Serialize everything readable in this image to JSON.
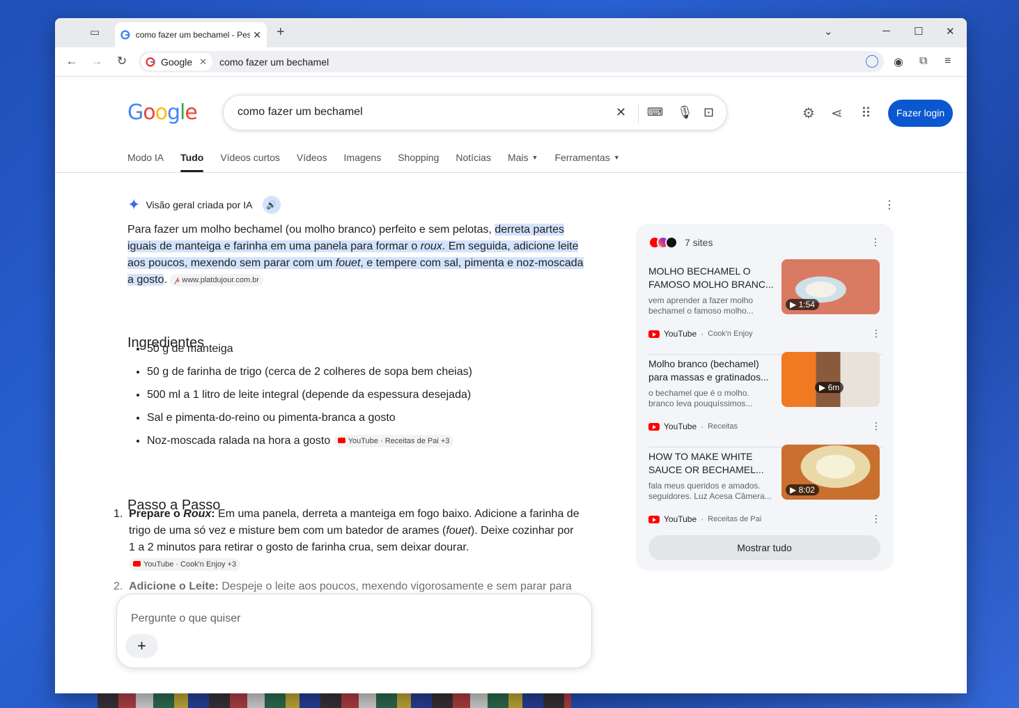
{
  "browser": {
    "tab_title": "como fazer um bechamel - Pesquisa Google",
    "omnibox_chip": "Google",
    "omnibox_text": "como fazer um bechamel"
  },
  "header": {
    "search_query": "como fazer um bechamel",
    "login_label": "Fazer login"
  },
  "tabs": [
    {
      "label": "Modo IA"
    },
    {
      "label": "Tudo"
    },
    {
      "label": "Vídeos curtos"
    },
    {
      "label": "Vídeos"
    },
    {
      "label": "Imagens"
    },
    {
      "label": "Shopping"
    },
    {
      "label": "Notícias"
    },
    {
      "label": "Mais"
    },
    {
      "label": "Ferramentas"
    }
  ],
  "ai": {
    "heading": "Visão geral criada por IA",
    "summary_plain": "Para fazer um molho bechamel (ou molho branco) perfeito e sem pelotas, ",
    "summary_hl1": "derreta partes iguais de manteiga e farinha em uma panela para formar o ",
    "summary_hl_roux": "roux",
    "summary_hl2": ". Em seguida, adicione leite aos poucos, mexendo sem parar com um ",
    "summary_hl_fouet": "fouet",
    "summary_hl3": ", e tempere com sal, pimenta e noz-moscada a gosto",
    "summary_end": ".",
    "summary_source": "www.platdujour.com.br",
    "ingredients_title": "Ingredientes",
    "ingredients": [
      "50 g de manteiga",
      "50 g de farinha de trigo (cerca de 2 colheres de sopa bem cheias)",
      "500 ml a 1 litro de leite integral (depende da espessura desejada)",
      "Sal e pimenta-do-reino ou pimenta-branca a gosto",
      "Noz-moscada ralada na hora a gosto"
    ],
    "ingredients_source": "YouTube · Receitas de Pai +3",
    "steps_title": "Passo a Passo",
    "step1_num": "1.",
    "step1_bold_a": "Prepare o ",
    "step1_bold_i": "Roux",
    "step1_bold_b": ":",
    "step1_text_a": " Em uma panela, derreta a manteiga em fogo baixo. Adicione a farinha de trigo de uma só vez e misture bem com um batedor de arames (",
    "step1_text_i": "fouet",
    "step1_text_b": "). Deixe cozinhar por 1 a 2 minutos para retirar o gosto de farinha crua, sem deixar dourar.",
    "step1_source": "YouTube · Cook'n Enjoy +3",
    "step2_num": "2.",
    "step2_bold": "Adicione o Leite:",
    "step2_text": " Despeje o leite aos poucos, mexendo vigorosamente e sem parar para"
  },
  "askbar": {
    "placeholder": "Pergunte o que quiser"
  },
  "sources": {
    "count_label": "7 sites",
    "cards": [
      {
        "title": "MOLHO BECHAMEL O FAMOSO MOLHO BRANC...",
        "snippet": "vem aprender a fazer molho bechamel o famoso molho...",
        "duration": "1:54",
        "platform": "YouTube",
        "channel": "Cook'n Enjoy"
      },
      {
        "title": "Molho branco (bechamel) para massas e gratinados...",
        "snippet": "o bechamel que é o molho. branco leva pouquíssimos...",
        "duration": "6m",
        "platform": "YouTube",
        "channel": "Receitas"
      },
      {
        "title": "HOW TO MAKE WHITE SAUCE OR BECHAMEL...",
        "snippet": "fala meus queridos e amados. seguidores. Luz Acesa Câmera...",
        "duration": "8:02",
        "platform": "YouTube",
        "channel": "Receitas de Pai"
      }
    ],
    "show_all": "Mostrar tudo"
  }
}
